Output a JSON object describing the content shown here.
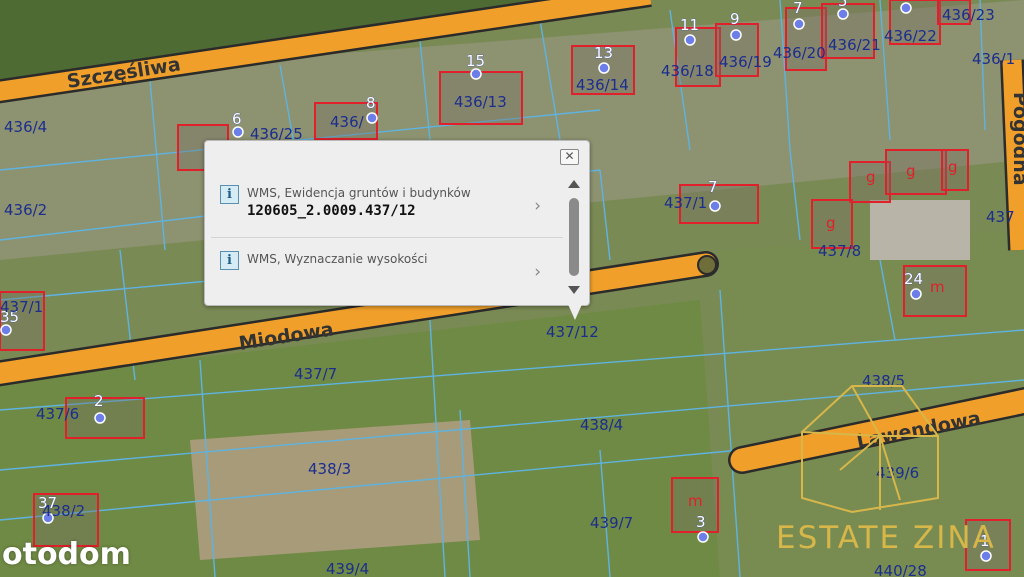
{
  "map": {
    "streets": {
      "szczesliwa": "Szczęśliwa",
      "miodowa": "Miodowa",
      "lawendowa": "Lawendowa",
      "pogodna": "Pogodna"
    },
    "parcels": {
      "p436_4": "436/4",
      "p436_2": "436/2",
      "p437_1": "437/1",
      "p436_25": "436/25",
      "p436_a": "436/",
      "p436_13": "436/13",
      "p436_14": "436/14",
      "p436_18": "436/18",
      "p436_19": "436/19",
      "p436_20": "436/20",
      "p436_21": "436/21",
      "p436_22": "436/22",
      "p436_23": "436/23",
      "p436_1": "436/1",
      "p437_10": "437/1",
      "p437_8": "437/8",
      "p437_12": "437/12",
      "p437_7": "437/7",
      "p437_6": "437/6",
      "p438_5": "438/5",
      "p438_4": "438/4",
      "p438_3": "438/3",
      "p439_6": "439/6",
      "p438_2": "438/2",
      "p439_7": "439/7",
      "p439_4": "439/4",
      "p440_28": "440/28",
      "p437_right": "437"
    },
    "address_numbers": {
      "n15": "15",
      "n13": "13",
      "n11": "11",
      "n9a": "9",
      "n7a": "7",
      "n5": "5",
      "n6": "6",
      "n8": "8",
      "n7b": "7",
      "n24": "24",
      "n35": "35",
      "n2": "2",
      "n37": "37",
      "n3": "3",
      "n1": "1"
    },
    "building_codes": {
      "g": "g",
      "m": "m"
    },
    "colors": {
      "street_fill": "#f0a02a",
      "street_outline": "#2b2b2b",
      "parcel_line": "#5fb3e0",
      "building_outline": "#e0202a",
      "address_point": "#6c7ee8",
      "parcel_label": "#1b2d8f"
    }
  },
  "popup": {
    "rows": [
      {
        "icon": "info-icon",
        "title": "WMS, Ewidencja gruntów i budynków",
        "value": "120605_2.0009.437/12",
        "chevron": "›"
      },
      {
        "icon": "info-icon",
        "title": "WMS, Wyznaczanie wysokości",
        "value": "",
        "chevron": "›"
      }
    ],
    "close_glyph": "✕",
    "info_glyph": "i"
  },
  "watermarks": {
    "otodom": "otodom",
    "estate": "ESTATE ZINA"
  }
}
